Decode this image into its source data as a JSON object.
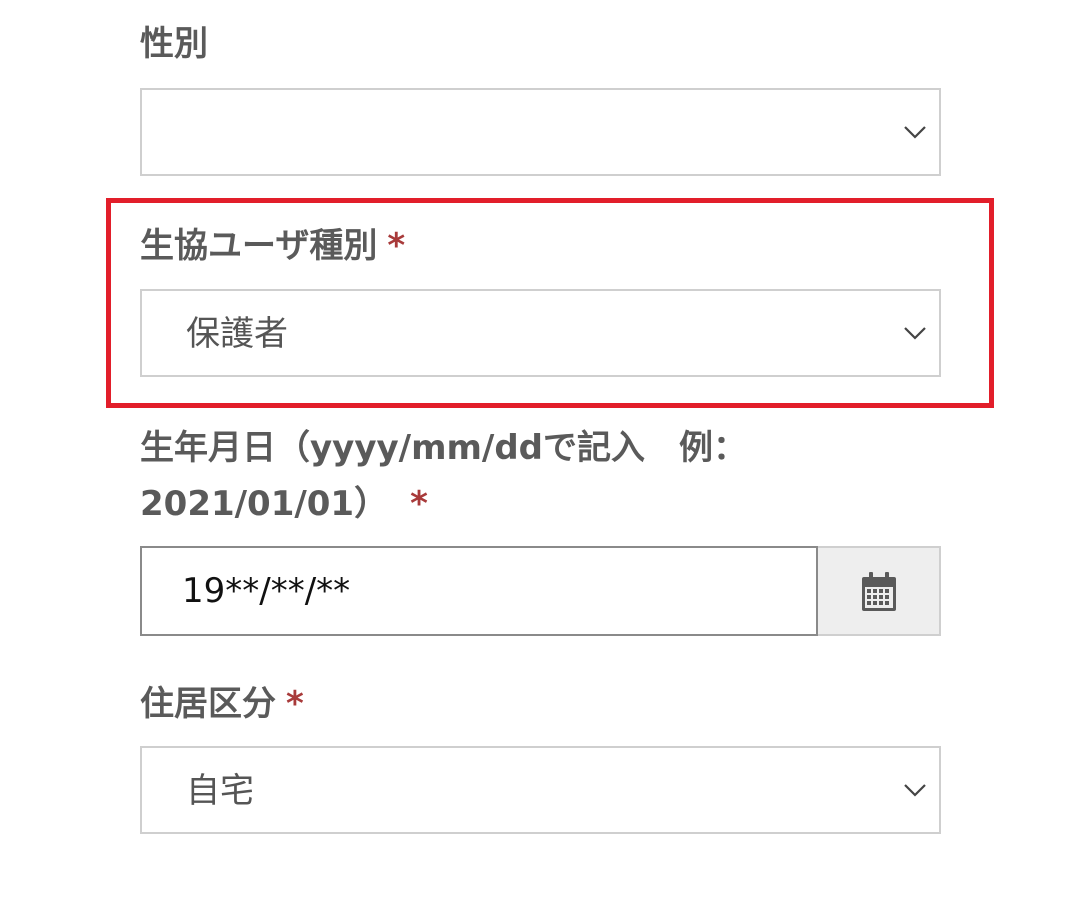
{
  "form": {
    "gender": {
      "label": "性別",
      "value": ""
    },
    "user_type": {
      "label": "生協ユーザ種別",
      "required_mark": "*",
      "value": "保護者"
    },
    "birthdate": {
      "label_line1": "生年月日（yyyy/mm/ddで記入　例：",
      "label_line2": "2021/01/01）",
      "required_mark": "*",
      "value": "19**/**/**"
    },
    "residence": {
      "label": "住居区分",
      "required_mark": "*",
      "value": "自宅"
    }
  },
  "icons": {
    "dropdown": "chevron-down-icon",
    "calendar": "calendar-icon"
  },
  "colors": {
    "highlight_border": "#e21e2a",
    "required_mark": "#a83a3a",
    "label_text": "#5a5a5a"
  }
}
